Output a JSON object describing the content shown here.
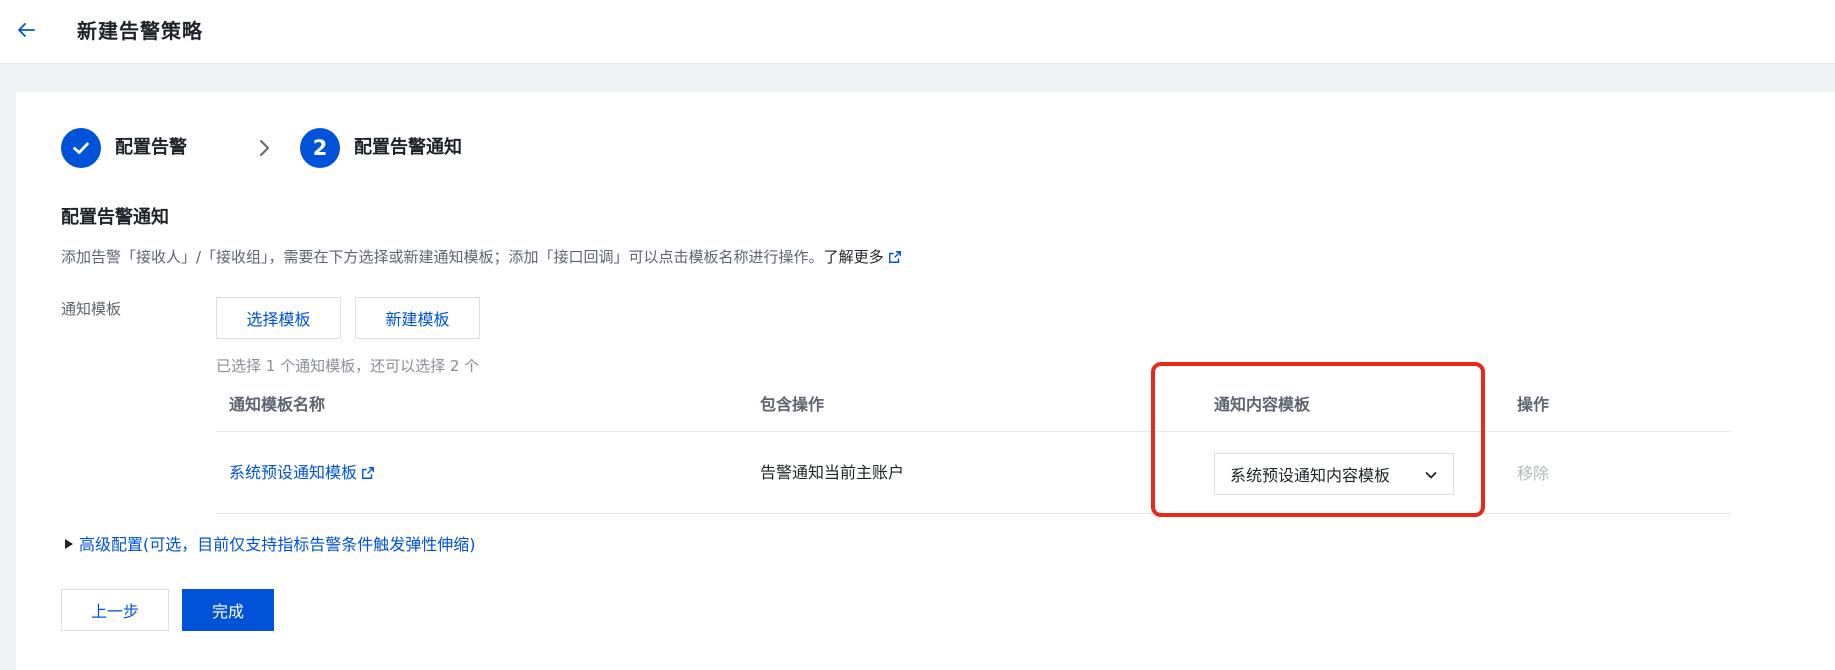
{
  "header": {
    "title": "新建告警策略",
    "back_icon": "arrow-left-icon"
  },
  "steps": [
    {
      "index": "",
      "label": "配置告警",
      "status": "done",
      "icon": "check-icon"
    },
    {
      "index": "2",
      "label": "配置告警通知",
      "status": "current"
    }
  ],
  "section": {
    "title": "配置告警通知",
    "description": "添加告警「接收人」/「接收组」，需要在下方选择或新建通知模板；添加「接口回调」可以点击模板名称进行操作。",
    "learn_more": "了解更多"
  },
  "notify_template": {
    "label": "通知模板",
    "select_button": "选择模板",
    "create_button": "新建模板",
    "hint": "已选择 1 个通知模板，还可以选择 2 个"
  },
  "table": {
    "headers": [
      "通知模板名称",
      "包含操作",
      "通知内容模板",
      "操作"
    ],
    "rows": [
      {
        "name": "系统预设通知模板",
        "operations": "告警通知当前主账户",
        "content_template": "系统预设通知内容模板",
        "action": "移除"
      }
    ]
  },
  "advanced": {
    "label": "高级配置(可选，目前仅支持指标告警条件触发弹性伸缩)"
  },
  "footer": {
    "prev": "上一步",
    "finish": "完成"
  },
  "colors": {
    "primary": "#0052d9",
    "highlight": "#e8291c"
  }
}
